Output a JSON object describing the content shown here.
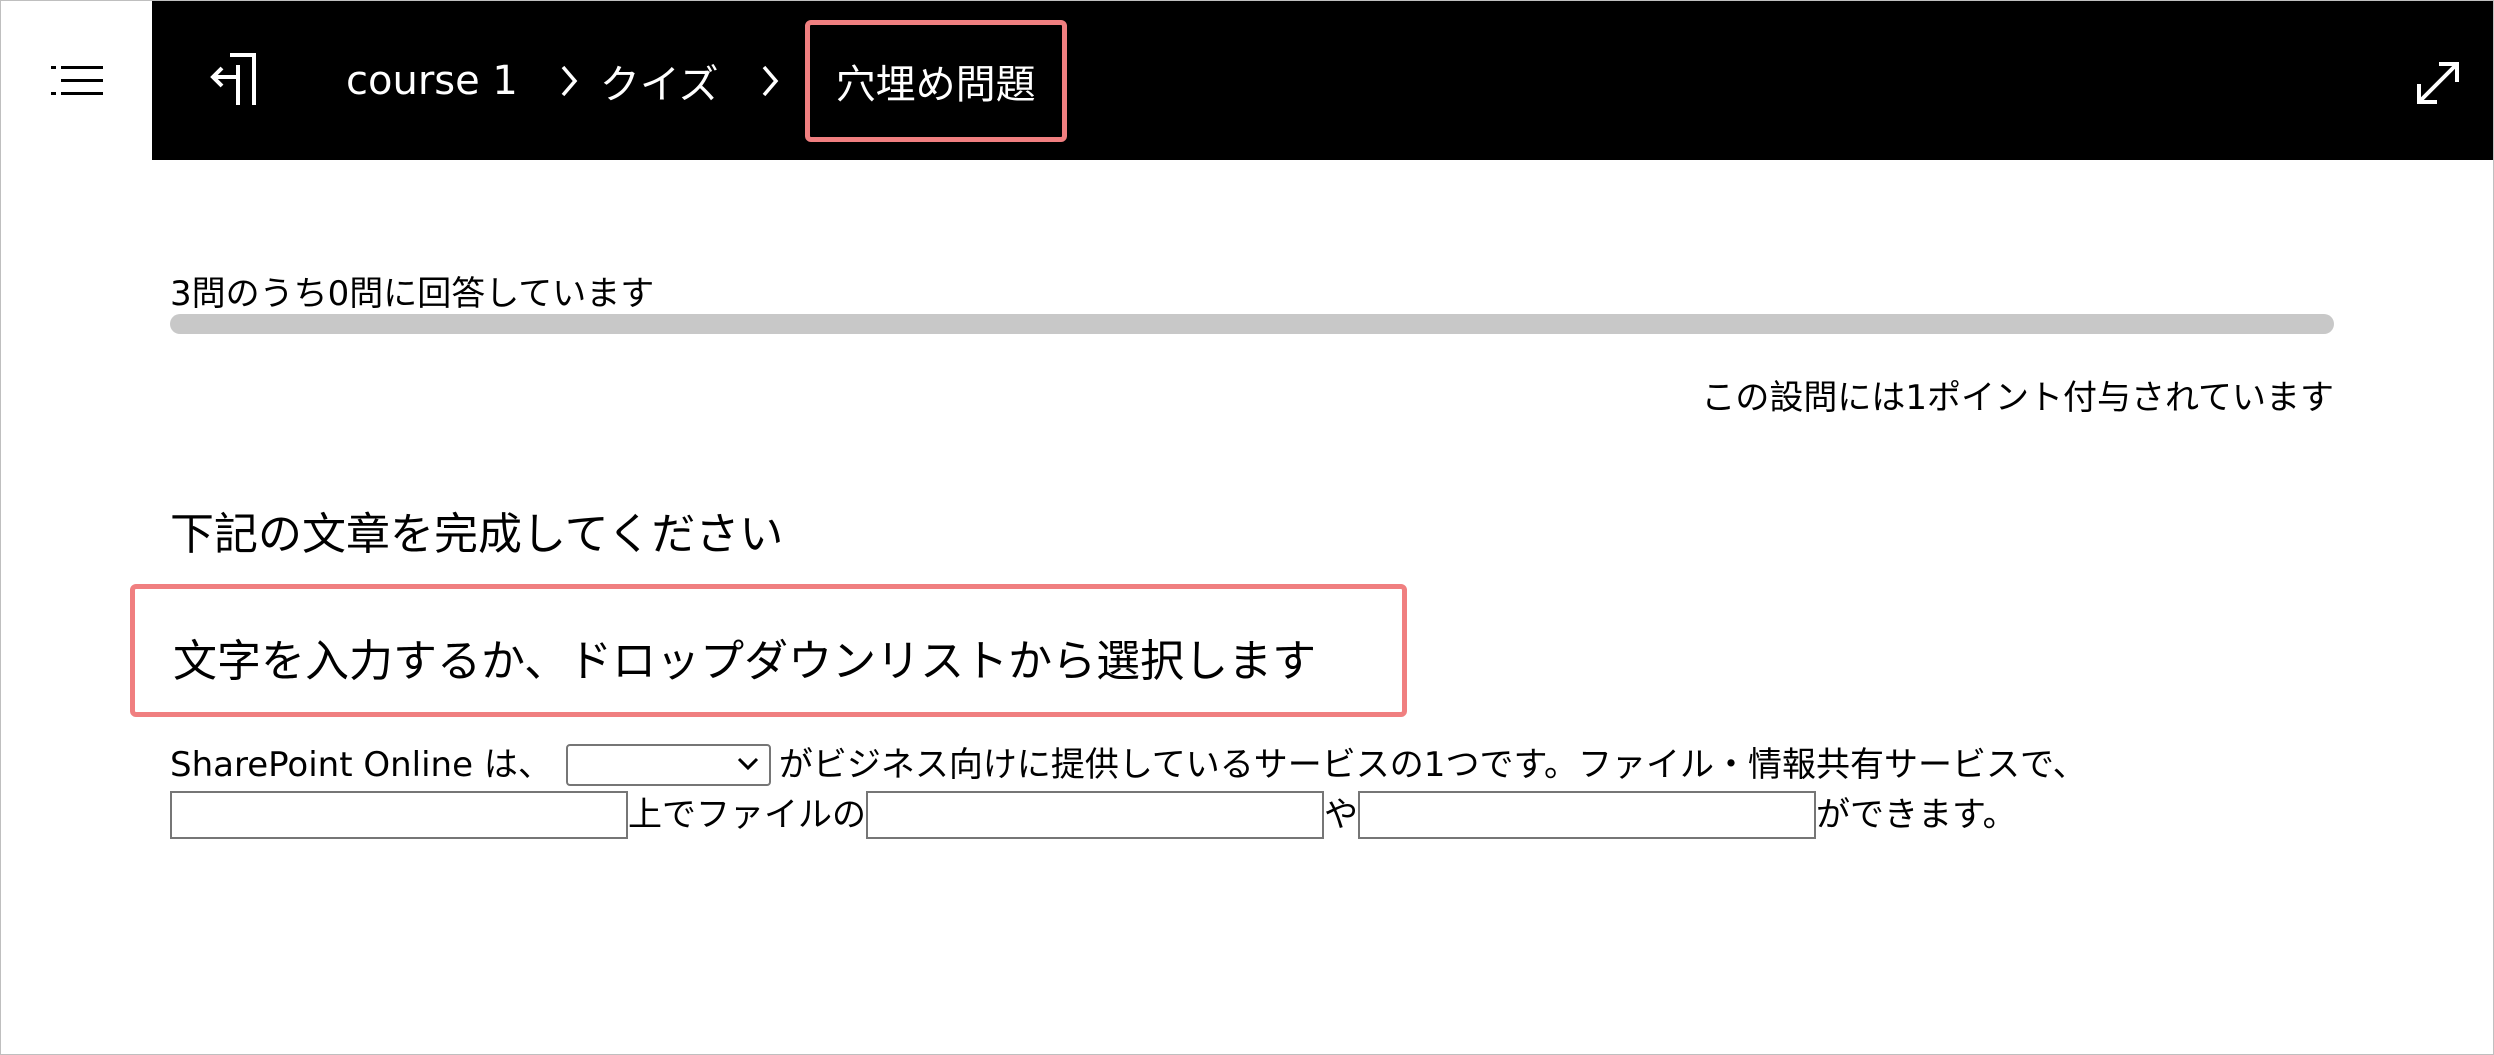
{
  "header": {
    "menu_icon": "list-menu-icon",
    "back_icon": "exit-back-icon",
    "expand_icon": "expand-diagonal-icon",
    "breadcrumb": {
      "course": "course 1",
      "quiz": "クイズ",
      "current": "穴埋め問題"
    }
  },
  "progress": {
    "label": "3問のうち0問に回答しています",
    "answered": 0,
    "total": 3
  },
  "question": {
    "points_text": "この設問には1ポイント付与されています",
    "title": "下記の文章を完成してください",
    "instruction": "文字を入力するか、ドロップダウンリストから選択します",
    "sentence": {
      "part1": "SharePoint Online は、",
      "dropdown_value": "",
      "part2": "がビジネス向けに提供しているサービスの1つです。ファイル・情報共有サービスで、",
      "blank1_value": "",
      "part3": "上でファイルの",
      "blank2_value": "",
      "part4": "や",
      "blank3_value": "",
      "part5": "ができます。"
    }
  },
  "colors": {
    "header_bg": "#000000",
    "highlight": "#f07f80",
    "progress_track": "#c8c8c8"
  }
}
